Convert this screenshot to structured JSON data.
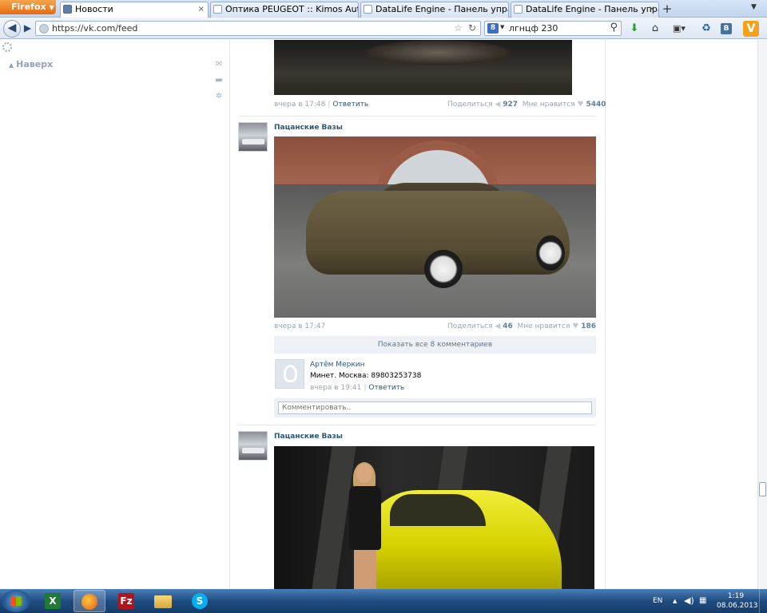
{
  "browser": {
    "menu_label": "Firefox",
    "tabs": [
      {
        "title": "Новости",
        "active": true
      },
      {
        "title": "Оптика PEUGEOT :: Kimos AutoTuning",
        "active": false
      },
      {
        "title": "DataLife Engine - Панель управления",
        "active": false
      },
      {
        "title": "DataLife Engine - Панель управления",
        "active": false
      }
    ],
    "new_tab": "+",
    "close_glyph": "×",
    "url": "https://vk.com/feed",
    "search_engine": "8",
    "search_query": "лгнцф 230"
  },
  "sidebar": {
    "up_label": "Наверх",
    "icons": [
      "mail-icon",
      "comment-icon",
      "gear-icon"
    ]
  },
  "feed": {
    "post1": {
      "time": "вчера в 17:48",
      "reply": "Ответить",
      "share_label": "Поделиться",
      "share_count": "927",
      "like_label": "Мне нравится",
      "like_count": "5440"
    },
    "post2": {
      "author": "Пацанские Вазы",
      "time": "вчера в 17:47",
      "share_label": "Поделиться",
      "share_count": "46",
      "like_label": "Мне нравится",
      "like_count": "186",
      "show_comments": "Показать все 8 комментариев",
      "comment": {
        "author": "Артём Меркин",
        "text": "Минет. Москва: 89803253738",
        "time": "вчера в 19:41",
        "reply": "Ответить"
      },
      "comment_placeholder": "Комментировать.."
    },
    "post3": {
      "author": "Пацанские Вазы"
    }
  },
  "taskbar": {
    "language": "EN",
    "time": "1:19",
    "date": "08.06.2013"
  }
}
